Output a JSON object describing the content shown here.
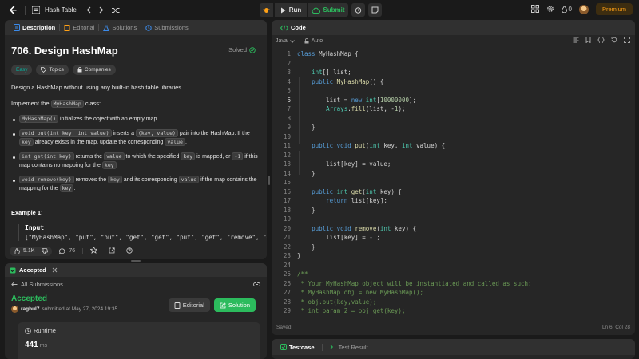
{
  "topbar": {
    "title": "Hash Table",
    "run_label": "Run",
    "submit_label": "Submit",
    "streak": "0",
    "premium_label": "Premium"
  },
  "desc_tabs": [
    "Description",
    "Editorial",
    "Solutions",
    "Submissions"
  ],
  "problem": {
    "title": "706. Design HashMap",
    "solved_label": "Solved",
    "difficulty": "Easy",
    "topics_label": "Topics",
    "companies_label": "Companies",
    "intro": "Design a HashMap without using any built-in hash table libraries.",
    "implement_pre": "Implement the ",
    "implement_code": "MyHashMap",
    "implement_post": " class:",
    "spec1_code": "MyHashMap()",
    "spec1_text": " initializes the object with an empty map.",
    "spec2_code1": "void put(int key, int value)",
    "spec2_t1": " inserts a ",
    "spec2_code2": "(key, value)",
    "spec2_t2": " pair into the HashMap. If the ",
    "spec2_code3": "key",
    "spec2_t3": " already exists in the map, update the corresponding ",
    "spec2_code4": "value",
    "spec2_t4": ".",
    "spec3_code1": "int get(int key)",
    "spec3_t1": " returns the ",
    "spec3_code2": "value",
    "spec3_t2": " to which the specified ",
    "spec3_code3": "key",
    "spec3_t3": " is mapped, or ",
    "spec3_code4": "-1",
    "spec3_t4": " if this map contains no mapping for the ",
    "spec3_code5": "key",
    "spec3_t5": ".",
    "spec4_code1": "void remove(key)",
    "spec4_t1": " removes the ",
    "spec4_code2": "key",
    "spec4_t2": " and its corresponding ",
    "spec4_code3": "value",
    "spec4_t3": " if the map contains the mapping for the ",
    "spec4_code4": "key",
    "spec4_t4": ".",
    "example_title": "Example 1:",
    "example_input_label": "Input",
    "example_input": "[\"MyHashMap\", \"put\", \"put\", \"get\", \"get\", \"put\", \"get\", \"remove\", \"get\"]"
  },
  "desc_footer": {
    "likes": "5.1K",
    "comments": "76"
  },
  "accepted": {
    "tab_label": "Accepted",
    "back_label": "All Submissions",
    "status": "Accepted",
    "user": "raghul7",
    "submitted_text": "submitted at May 27, 2024 19:35",
    "editorial_label": "Editorial",
    "solution_label": "Solution",
    "runtime_label": "Runtime",
    "runtime_value": "441",
    "runtime_unit": "ms"
  },
  "code_panel": {
    "tab_label": "Code",
    "language": "Java",
    "auto_label": "Auto",
    "saved_label": "Saved",
    "cursor_pos": "Ln 6, Col 28",
    "lines": [
      "class MyHashMap {",
      "",
      "    int[] list;",
      "    public MyHashMap() {",
      "",
      "        list = new int[10000000];",
      "        Arrays.fill(list, -1);",
      "",
      "    }",
      "",
      "    public void put(int key, int value) {",
      "",
      "        list[key] = value;",
      "    }",
      "",
      "    public int get(int key) {",
      "        return list[key];",
      "    }",
      "",
      "    public void remove(int key) {",
      "        list[key] = -1;",
      "    }",
      "}",
      "",
      "/**",
      " * Your MyHashMap object will be instantiated and called as such:",
      " * MyHashMap obj = new MyHashMap();",
      " * obj.put(key,value);",
      " * int param_2 = obj.get(key);"
    ]
  },
  "test_panel": {
    "testcase_label": "Testcase",
    "result_label": "Test Result"
  }
}
